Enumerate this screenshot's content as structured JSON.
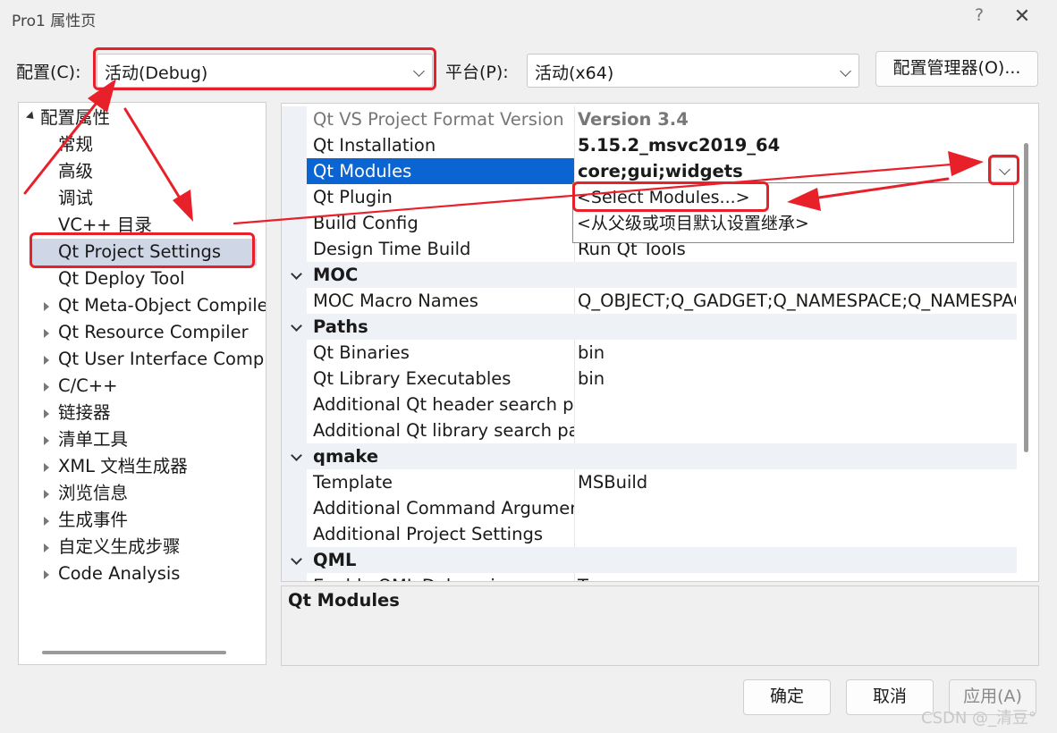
{
  "window": {
    "title": "Pro1 属性页",
    "help_glyph": "?",
    "close_glyph": "✕"
  },
  "toolbar": {
    "config_label": "配置(C):",
    "config_value": "活动(Debug)",
    "platform_label": "平台(P):",
    "platform_value": "活动(x64)",
    "config_manager_button": "配置管理器(O)..."
  },
  "tree": {
    "root": "配置属性",
    "items": [
      {
        "label": "常规",
        "expandable": false
      },
      {
        "label": "高级",
        "expandable": false
      },
      {
        "label": "调试",
        "expandable": false
      },
      {
        "label": "VC++ 目录",
        "expandable": false
      },
      {
        "label": "Qt Project Settings",
        "expandable": false,
        "selected": true
      },
      {
        "label": "Qt Deploy Tool",
        "expandable": false
      },
      {
        "label": "Qt Meta-Object Compiler",
        "expandable": true
      },
      {
        "label": "Qt Resource Compiler",
        "expandable": true
      },
      {
        "label": "Qt User Interface Compiler",
        "expandable": true
      },
      {
        "label": "C/C++",
        "expandable": true
      },
      {
        "label": "链接器",
        "expandable": true
      },
      {
        "label": "清单工具",
        "expandable": true
      },
      {
        "label": "XML 文档生成器",
        "expandable": true
      },
      {
        "label": "浏览信息",
        "expandable": true
      },
      {
        "label": "生成事件",
        "expandable": true
      },
      {
        "label": "自定义生成步骤",
        "expandable": true
      },
      {
        "label": "Code Analysis",
        "expandable": true
      }
    ]
  },
  "grid": {
    "rows": [
      {
        "kind": "prop",
        "name": "Qt VS Project Format Version",
        "value": "Version 3.4",
        "readonly": true,
        "bold": true
      },
      {
        "kind": "prop",
        "name": "Qt Installation",
        "value": "5.15.2_msvc2019_64",
        "bold": true
      },
      {
        "kind": "prop",
        "name": "Qt Modules",
        "value": "core;gui;widgets",
        "bold": true,
        "selected": true
      },
      {
        "kind": "prop",
        "name": "Qt Plugin",
        "value": ""
      },
      {
        "kind": "prop",
        "name": "Build Config",
        "value": ""
      },
      {
        "kind": "prop",
        "name": "Design Time Build",
        "value": "Run Qt Tools"
      },
      {
        "kind": "cat",
        "name": "MOC"
      },
      {
        "kind": "prop",
        "name": "MOC Macro Names",
        "value": "Q_OBJECT;Q_GADGET;Q_NAMESPACE;Q_NAMESPACE_EXPORT"
      },
      {
        "kind": "cat",
        "name": "Paths"
      },
      {
        "kind": "prop",
        "name": "Qt Binaries",
        "value": "bin"
      },
      {
        "kind": "prop",
        "name": "Qt Library Executables",
        "value": "bin"
      },
      {
        "kind": "prop",
        "name": "Additional Qt header search paths",
        "value": ""
      },
      {
        "kind": "prop",
        "name": "Additional Qt library search paths",
        "value": ""
      },
      {
        "kind": "cat",
        "name": "qmake"
      },
      {
        "kind": "prop",
        "name": "Template",
        "value": "MSBuild"
      },
      {
        "kind": "prop",
        "name": "Additional Command Arguments",
        "value": ""
      },
      {
        "kind": "prop",
        "name": "Additional Project Settings",
        "value": ""
      },
      {
        "kind": "cat",
        "name": "QML"
      },
      {
        "kind": "prop",
        "name": "Enable QML Debugging",
        "value": "True"
      }
    ]
  },
  "dropdown": {
    "options": [
      "<Select Modules...>",
      "<从父级或项目默认设置继承>"
    ]
  },
  "description": {
    "title": "Qt Modules"
  },
  "buttons": {
    "ok": "确定",
    "cancel": "取消",
    "apply": "应用(A)"
  },
  "watermark": "CSDN @_清豆°",
  "colors": {
    "selection": "#0a64d2",
    "tree_selection": "#cfd6e6",
    "annotation": "#e8202a",
    "category_band": "#eef2f7"
  }
}
